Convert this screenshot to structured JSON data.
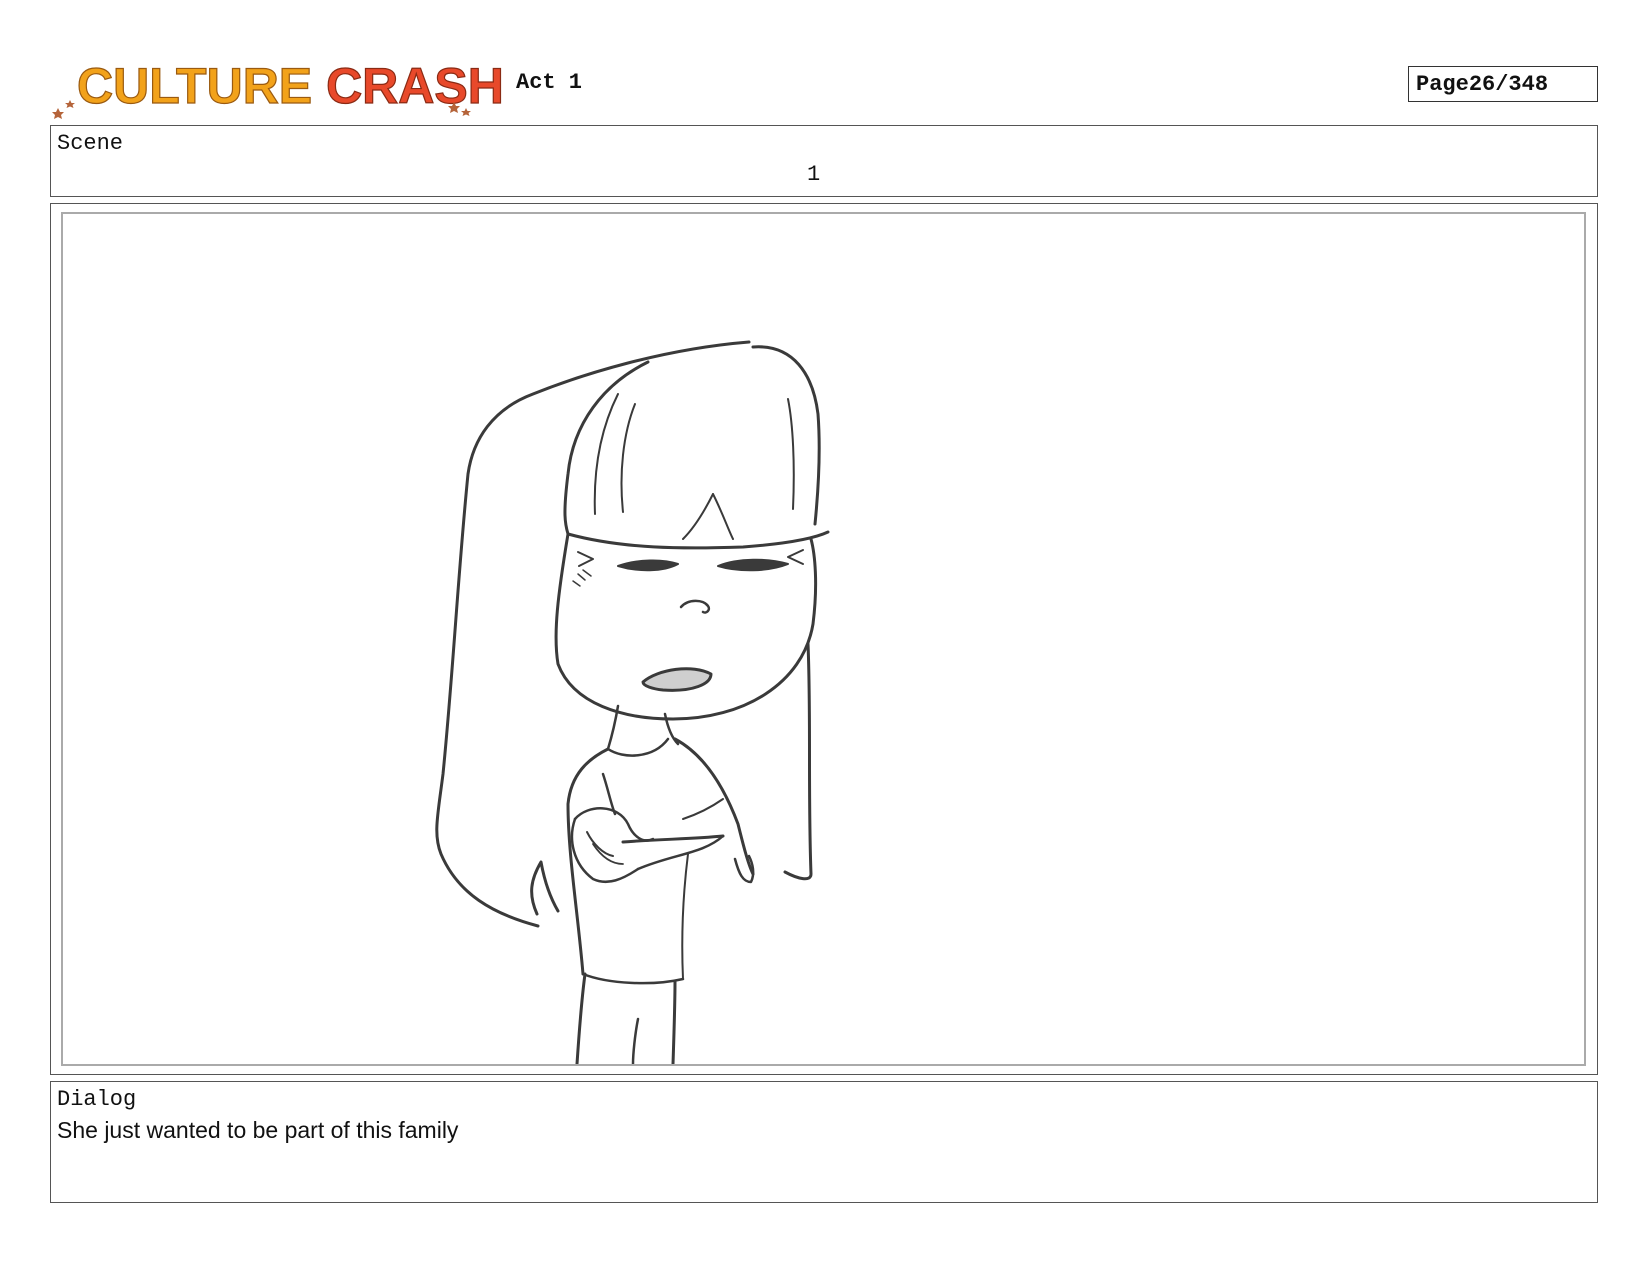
{
  "header": {
    "logo_text": "CULTURE CRASH",
    "act": "Act 1",
    "page_label": "Page",
    "page_number": "26/348"
  },
  "scene": {
    "label": "Scene",
    "number": "1"
  },
  "panel": {
    "subject": "sketch-girl-arms-crossed"
  },
  "dialog": {
    "label": "Dialog",
    "text": "She just wanted to be part of this family"
  },
  "colors": {
    "logo_orange": "#f2a21a",
    "logo_red": "#e8492a",
    "logo_star": "#b5643a",
    "sketch": "#3a3a3a"
  }
}
